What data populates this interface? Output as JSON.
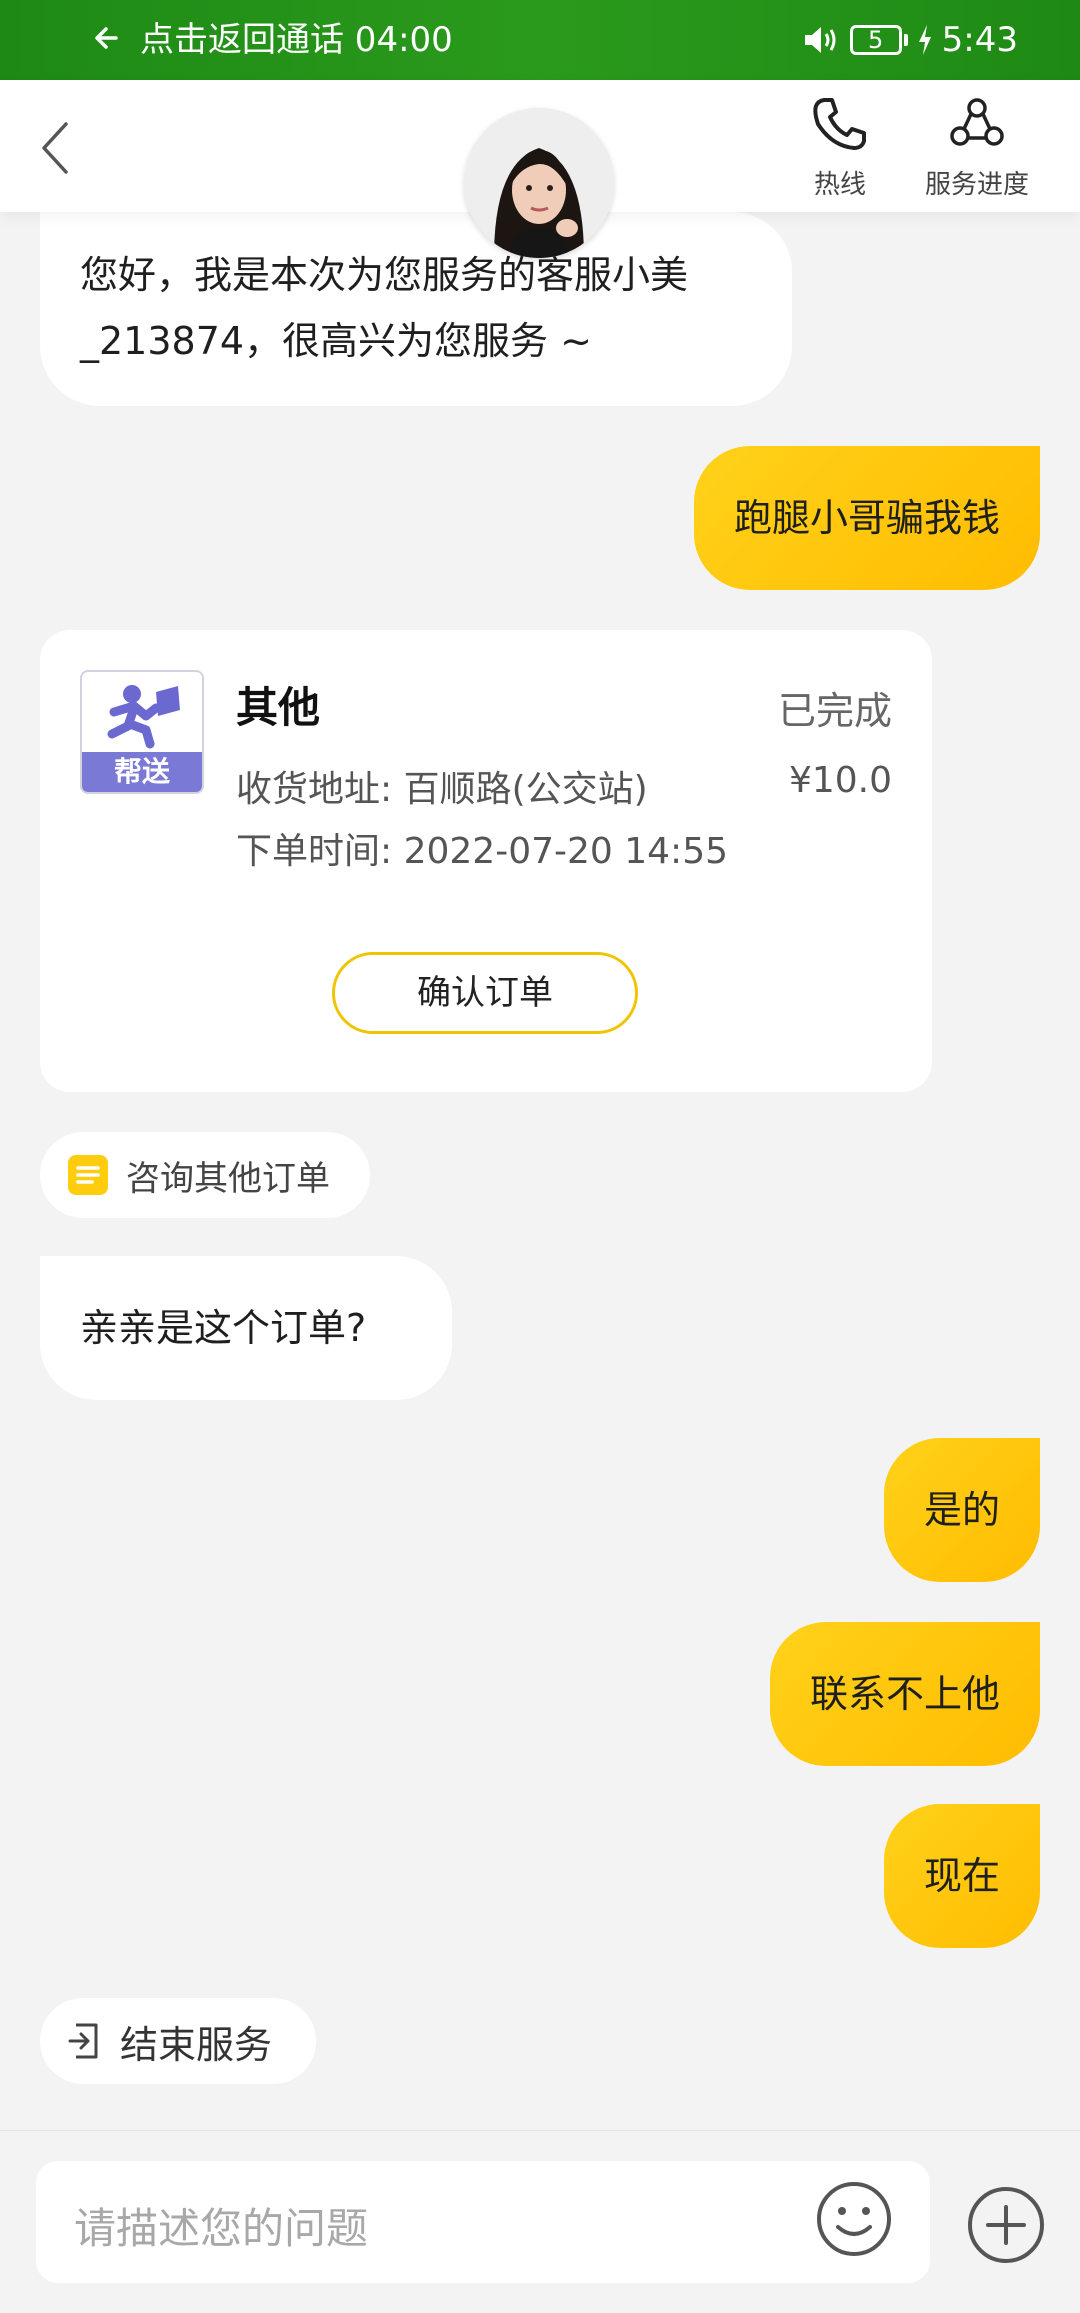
{
  "status_bar": {
    "call_text": "点击返回通话 04:00",
    "battery": "5",
    "time": "5:43"
  },
  "header": {
    "hotline_label": "热线",
    "progress_label": "服务进度"
  },
  "messages": {
    "greeting": "您好，我是本次为您服务的客服小美_213874，很高兴为您服务 ~",
    "user_1": "跑腿小哥骗我钱",
    "agent_question": "亲亲是这个订单?",
    "user_2": "是的",
    "user_3": "联系不上他",
    "user_4": "现在"
  },
  "order_card": {
    "icon_label": "帮送",
    "title": "其他",
    "status": "已完成",
    "address_label": "收货地址:",
    "address_value": "百顺路(公交站)",
    "price": "¥10.0",
    "time_label": "下单时间:",
    "time_value": "2022-07-20 14:55",
    "confirm_label": "确认订单"
  },
  "chips": {
    "consult_other": "咨询其他订单",
    "end_service": "结束服务"
  },
  "input": {
    "placeholder": "请描述您的问题"
  },
  "colors": {
    "status_bar": "#1e8a15",
    "accent_yellow": "#ffc400",
    "order_icon_strip": "#7b79d6"
  }
}
